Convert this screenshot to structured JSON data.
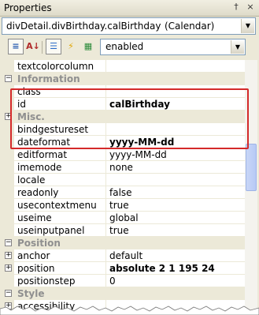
{
  "title": "Properties",
  "title_buttons": {
    "pin": "†",
    "close": "×"
  },
  "object_selector": {
    "name": "divDetail.divBirthday.calBirthday",
    "type": "(Calendar)"
  },
  "toolbar": {
    "categorized": "≡",
    "alphabetical": "A↓",
    "properties": "☰",
    "events": "⚡",
    "pages": "▦"
  },
  "filter": {
    "value": "enabled"
  },
  "dropdown_arrow": "▼",
  "expander": {
    "expanded": "−",
    "collapsed": "+"
  },
  "rows": [
    {
      "kind": "prop",
      "name": "textcolorcolumn",
      "value": ""
    },
    {
      "kind": "category",
      "name": "Information",
      "expander": "expanded"
    },
    {
      "kind": "prop",
      "name": "class",
      "value": ""
    },
    {
      "kind": "prop",
      "name": "id",
      "value": "calBirthday",
      "bold": true
    },
    {
      "kind": "category",
      "name": "Misc.",
      "expander": "collapsed"
    },
    {
      "kind": "prop",
      "name": "bindgestureset",
      "value": ""
    },
    {
      "kind": "prop",
      "name": "dateformat",
      "value": "yyyy-MM-dd",
      "bold": true
    },
    {
      "kind": "prop",
      "name": "editformat",
      "value": "yyyy-MM-dd"
    },
    {
      "kind": "prop",
      "name": "imemode",
      "value": "none"
    },
    {
      "kind": "prop",
      "name": "locale",
      "value": ""
    },
    {
      "kind": "prop",
      "name": "readonly",
      "value": "false"
    },
    {
      "kind": "prop",
      "name": "usecontextmenu",
      "value": "true"
    },
    {
      "kind": "prop",
      "name": "useime",
      "value": "global"
    },
    {
      "kind": "prop",
      "name": "useinputpanel",
      "value": "true"
    },
    {
      "kind": "category",
      "name": "Position",
      "expander": "expanded"
    },
    {
      "kind": "prop",
      "name": "anchor",
      "value": "default",
      "expander": "collapsed"
    },
    {
      "kind": "prop",
      "name": "position",
      "value": "absolute 2 1 195 24",
      "bold": true,
      "expander": "collapsed"
    },
    {
      "kind": "prop",
      "name": "positionstep",
      "value": "0"
    },
    {
      "kind": "category",
      "name": "Style",
      "expander": "expanded"
    },
    {
      "kind": "prop",
      "name": "accessibility",
      "value": "",
      "expander": "collapsed"
    }
  ],
  "colors": {
    "highlight": "#d42a2a",
    "category_text": "#8f8f8f"
  }
}
